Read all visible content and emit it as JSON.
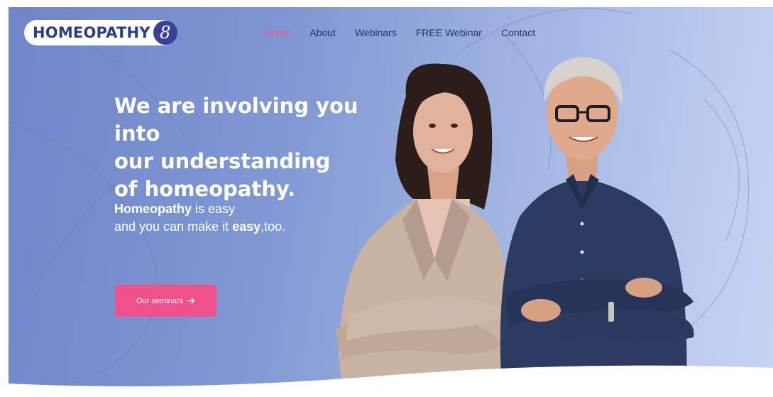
{
  "logo": {
    "text": "HOMEOPATHY",
    "badge": "8"
  },
  "nav": {
    "items": [
      {
        "label": "Home",
        "active": true
      },
      {
        "label": "About",
        "active": false
      },
      {
        "label": "Webinars",
        "active": false
      },
      {
        "label": "FREE Webinar",
        "active": false
      },
      {
        "label": "Contact",
        "active": false
      }
    ]
  },
  "hero": {
    "headline_lines": [
      "We are involving you into",
      "our understanding",
      "of homeopathy."
    ],
    "sub_line1_bold": "Homeopathy",
    "sub_line1_rest": " is easy",
    "sub_line2_start": "and you can make it ",
    "sub_line2_bold": "easy",
    "sub_line2_end": ",too.",
    "cta_label": "Our seminars",
    "cta_icon": "arrow-right-icon"
  },
  "colors": {
    "accent": "#f0508c",
    "nav_active": "#e8588f",
    "brand_navy": "#2e3a8c",
    "hero_start": "#6f86c9",
    "hero_end": "#c6d3f2"
  }
}
